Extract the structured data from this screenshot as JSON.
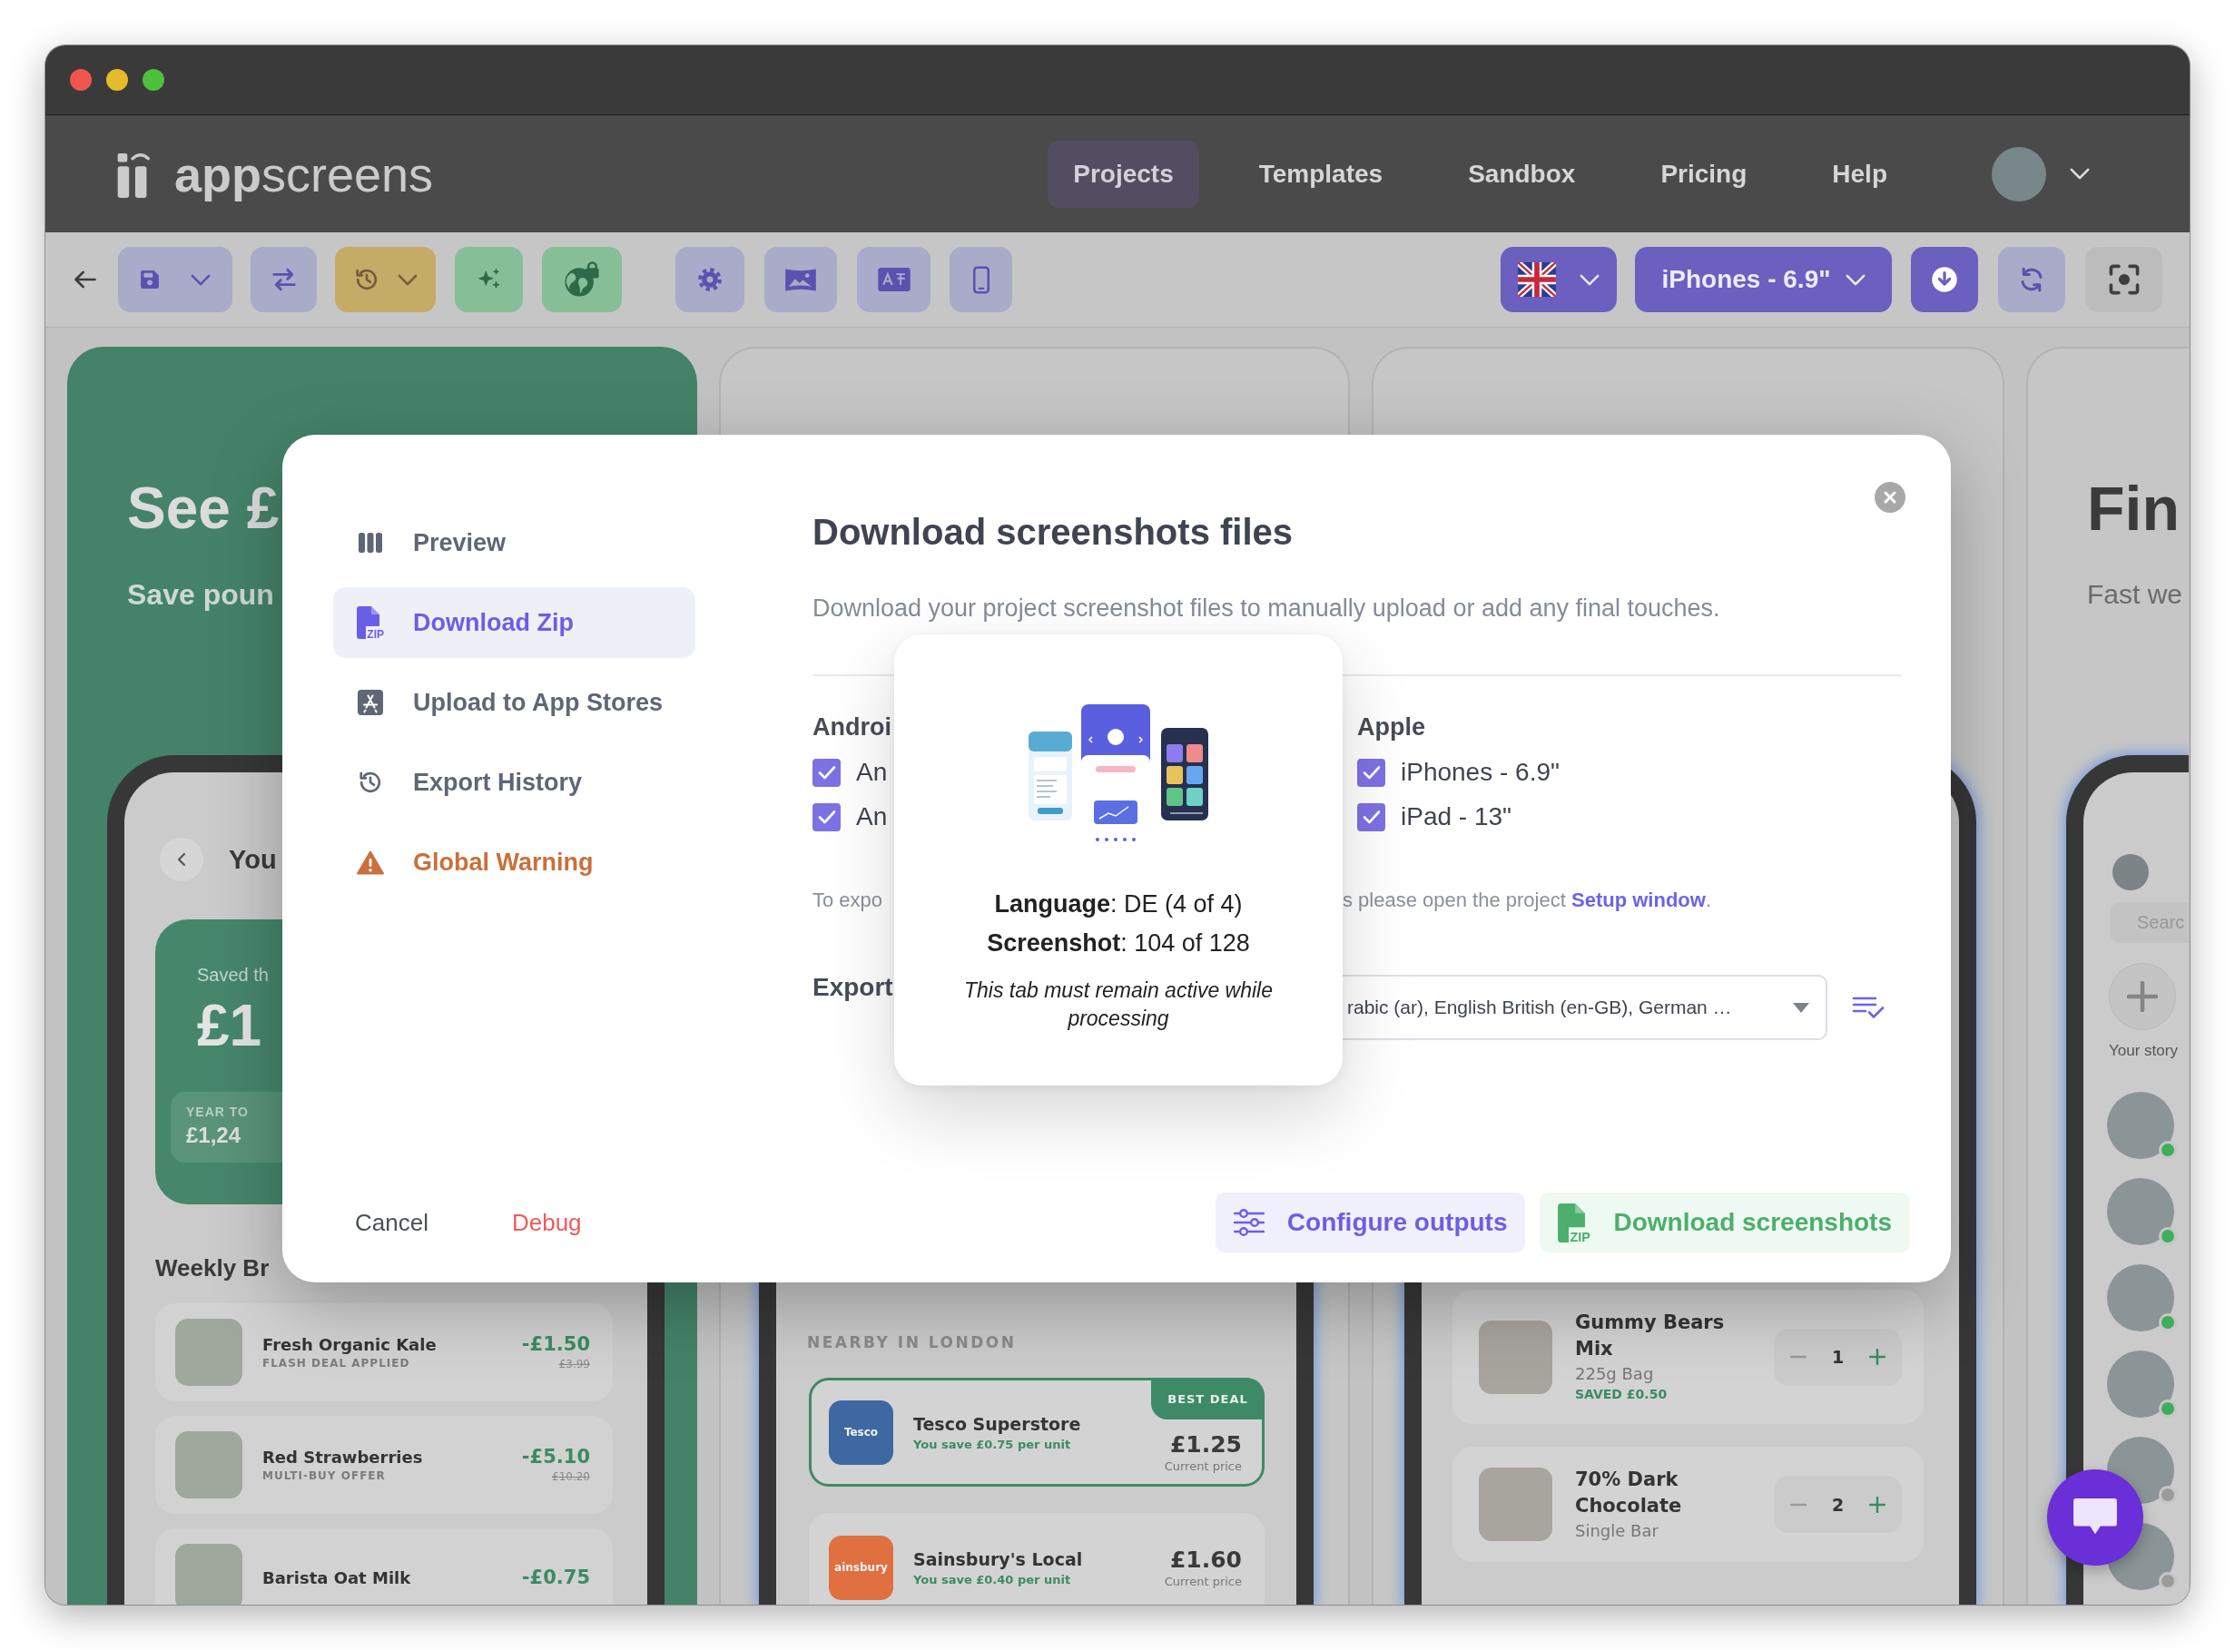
{
  "header": {
    "logo": "**app**screens",
    "nav": [
      {
        "label": "Projects",
        "selected": true
      },
      {
        "label": "Templates",
        "selected": false
      },
      {
        "label": "Sandbox",
        "selected": false
      },
      {
        "label": "Pricing",
        "selected": false
      },
      {
        "label": "Help",
        "selected": false
      }
    ]
  },
  "toolbar": {
    "device": "iPhones - 6.9\""
  },
  "canvas": {
    "cards": [
      {
        "kind": "savings",
        "headline": "See £",
        "subhead": "Save poun",
        "screen_title": "You",
        "summary": {
          "caption": "Saved th",
          "amount": "£1",
          "pill_label": "YEAR TO",
          "pill_value": "£1,24"
        },
        "section": "Weekly Br",
        "items": [
          {
            "name": "Fresh Organic Kale",
            "tag": "FLASH DEAL APPLIED",
            "saving": "-£1.50",
            "was": "£3.99"
          },
          {
            "name": "Red Strawberries",
            "tag": "MULTI-BUY OFFER",
            "saving": "-£5.10",
            "was": "£10.20"
          },
          {
            "name": "Barista Oat Milk",
            "saving": "-£0.75"
          }
        ]
      },
      {
        "kind": "nearby",
        "section": "NEARBY IN LONDON",
        "stores": [
          {
            "logo": "Tesco",
            "color": "#3e68a1",
            "name": "Tesco Superstore",
            "saving": "You save £0.75 per unit",
            "price": "£1.25",
            "price_label": "Current price",
            "best": true,
            "badge": "BEST DEAL"
          },
          {
            "logo": "ainsbury",
            "color": "#e0703f",
            "name": "Sainsbury's Local",
            "saving": "You save £0.40 per unit",
            "price": "£1.60",
            "price_label": "Current price",
            "best": false
          }
        ]
      },
      {
        "kind": "basket",
        "items": [
          {
            "name": "Gummy Bears Mix",
            "size": "225g Bag",
            "saved": "SAVED £0.50",
            "quantity": "1"
          },
          {
            "name": "70% Dark Chocolate",
            "size": "Single Bar",
            "quantity": "2"
          }
        ]
      },
      {
        "kind": "stories",
        "headline": "Fin",
        "subhead": "Fast we",
        "search": {
          "placeholder": "Searc"
        },
        "add_label": "Your story",
        "stories": [
          {
            "online": true
          },
          {
            "online": true
          },
          {
            "online": true
          },
          {
            "online": true
          },
          {
            "online": false
          },
          {
            "online": false
          }
        ]
      }
    ]
  },
  "modal": {
    "menu": [
      {
        "kind": "preview",
        "label": "Preview",
        "selected": false
      },
      {
        "kind": "zip",
        "label": "Download Zip",
        "icon_label": "ZIP",
        "selected": true
      },
      {
        "kind": "stores",
        "label": "Upload to App Stores",
        "selected": false
      },
      {
        "kind": "history",
        "label": "Export History",
        "selected": false
      },
      {
        "kind": "warning",
        "label": "Global Warning",
        "selected": false
      }
    ],
    "title": "Download screenshots files",
    "description": "Download your project screenshot files to manually upload or add any final touches.",
    "platforms": [
      {
        "heading": "Androi",
        "options": [
          {
            "label": "An",
            "checked": true
          },
          {
            "label": "An",
            "checked": true
          }
        ]
      },
      {
        "heading": "Apple",
        "options": [
          {
            "label": "iPhones - 6.9\"",
            "checked": true
          },
          {
            "label": "iPad - 13\"",
            "checked": true
          }
        ]
      }
    ],
    "note": {
      "left": "To expo",
      "right": "s please open the project",
      "link": "Setup window",
      "end": "."
    },
    "export": {
      "label": "Export",
      "value": "rabic (ar), English British (en-GB), German …"
    },
    "progress": {
      "language": "**Language**: DE (4 of 4)",
      "screenshot": "**Screenshot**: 104 of 128",
      "notice": "This tab must remain active while processing"
    },
    "footer": {
      "cancel": "Cancel",
      "debug": "Debug",
      "configure": "Configure outputs",
      "download": {
        "label": "Download screenshots",
        "icon_label": "ZIP"
      }
    }
  }
}
